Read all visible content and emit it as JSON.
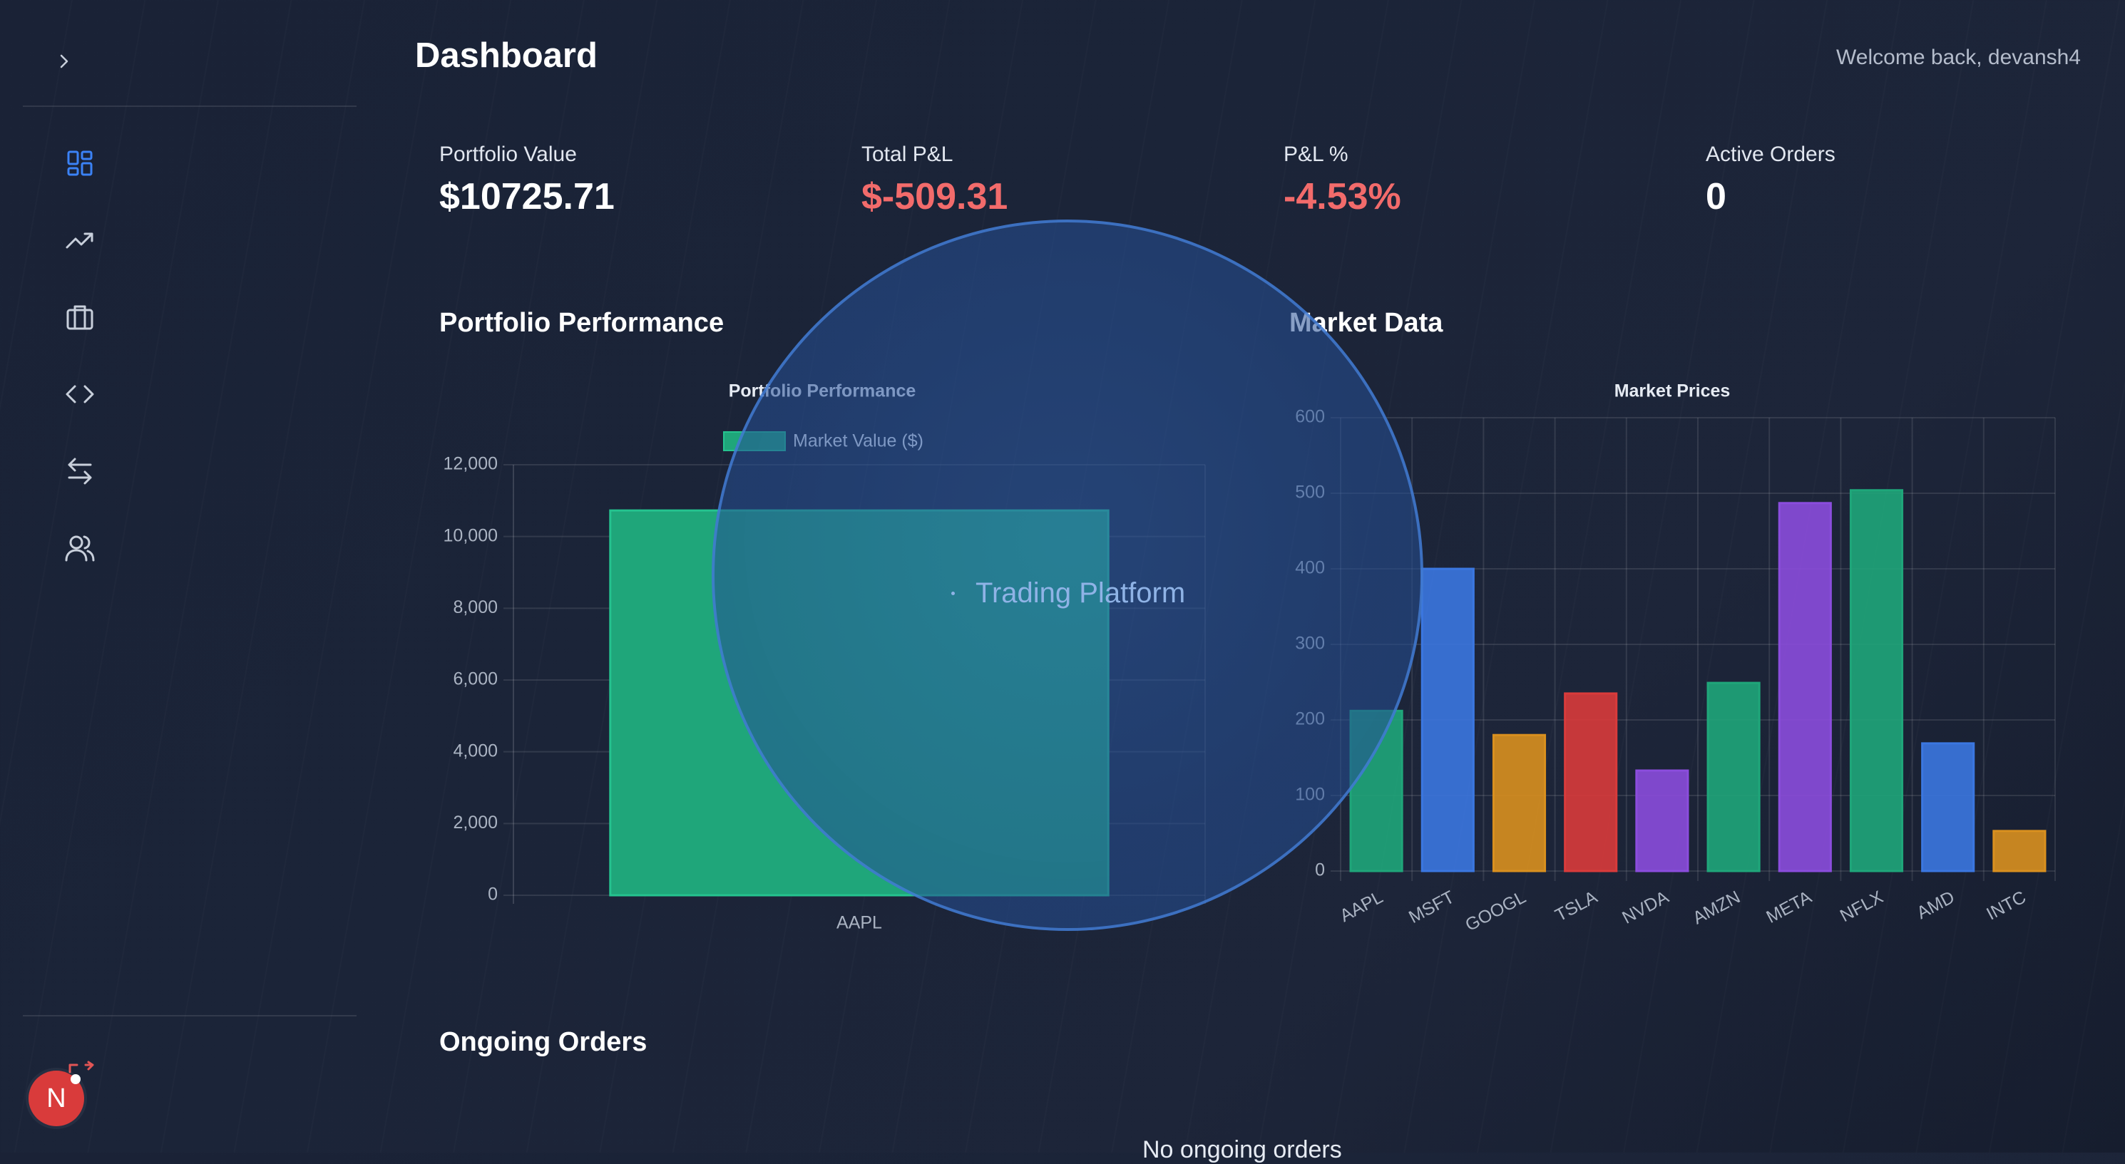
{
  "header": {
    "title": "Dashboard",
    "welcome": "Welcome back, devansh4"
  },
  "sidebar": {
    "items": [
      {
        "id": "dashboard",
        "icon": "dashboard-icon"
      },
      {
        "id": "trending",
        "icon": "trending-up-icon"
      },
      {
        "id": "portfolio",
        "icon": "briefcase-icon"
      },
      {
        "id": "code",
        "icon": "code-icon"
      },
      {
        "id": "transfer",
        "icon": "arrows-exchange-icon"
      },
      {
        "id": "users",
        "icon": "users-icon"
      }
    ],
    "avatar_initial": "N",
    "active_color": "#3b82f6"
  },
  "stats": [
    {
      "label": "Portfolio Value",
      "value": "$10725.71"
    },
    {
      "label": "Total P&L",
      "value": "$-509.31"
    },
    {
      "label": "P&L %",
      "value": "-4.53%"
    },
    {
      "label": "Active Orders",
      "value": "0"
    }
  ],
  "sections": {
    "portfolio_title": "Portfolio Performance",
    "market_title": "Market Data",
    "orders_title": "Ongoing Orders",
    "orders_empty": "No ongoing orders"
  },
  "overlay": {
    "label": "Trading Platform"
  },
  "colors": {
    "negative": "#f26b6b",
    "green": "#1fa67a",
    "blue": "#3b77e0",
    "orange": "#d9901f",
    "red": "#d93b3b",
    "purple": "#8b4ddd"
  },
  "chart_data": [
    {
      "type": "bar",
      "title": "Portfolio Performance",
      "categories": [
        "AAPL"
      ],
      "series": [
        {
          "name": "Market Value ($)",
          "values": [
            10725.71
          ]
        }
      ],
      "ylim": [
        0,
        12000
      ],
      "yticks": [
        "0",
        "2,000",
        "4,000",
        "6,000",
        "8,000",
        "10,000",
        "12,000"
      ],
      "legend": "top",
      "grid": true
    },
    {
      "type": "bar",
      "title": "Market Prices",
      "categories": [
        "AAPL",
        "MSFT",
        "GOOGL",
        "TSLA",
        "NVDA",
        "AMZN",
        "META",
        "NFLX",
        "AMD",
        "INTC"
      ],
      "values": [
        212,
        400,
        180,
        235,
        133,
        249,
        487,
        504,
        169,
        53
      ],
      "bar_colors": [
        "#1fa67a",
        "#3b77e0",
        "#d9901f",
        "#d93b3b",
        "#8b4ddd",
        "#1fa67a",
        "#8b4ddd",
        "#1fa67a",
        "#3b77e0",
        "#d9901f"
      ],
      "ylim": [
        0,
        600
      ],
      "yticks": [
        "0",
        "100",
        "200",
        "300",
        "400",
        "500",
        "600"
      ],
      "grid": true
    }
  ]
}
